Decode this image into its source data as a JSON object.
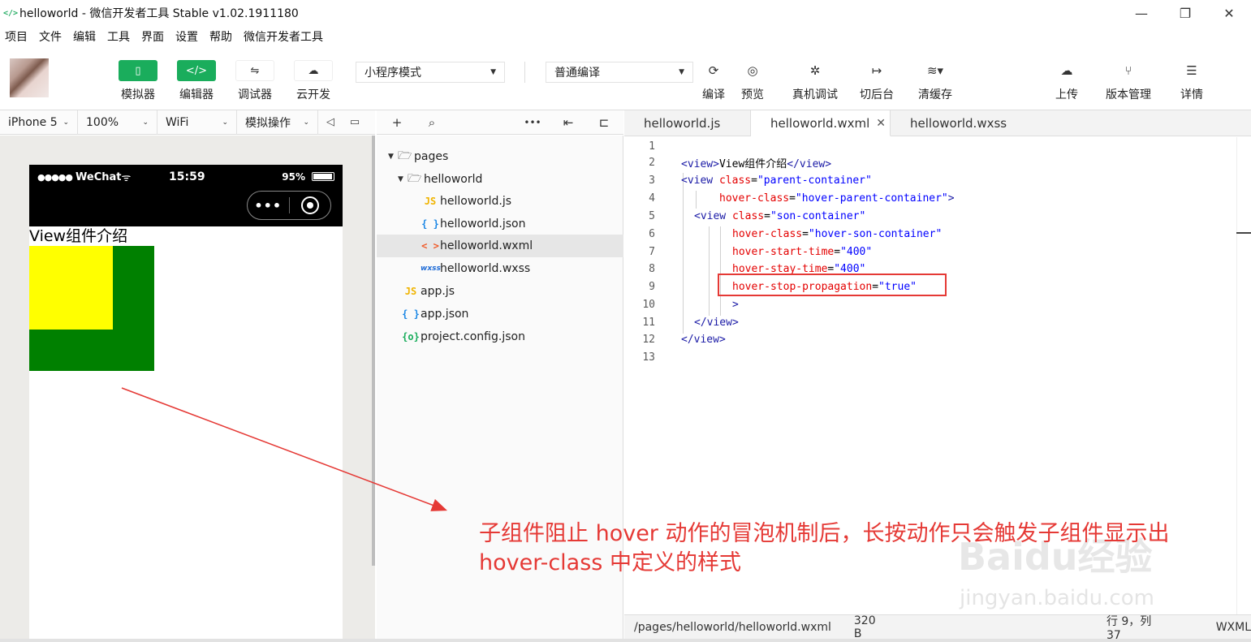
{
  "window": {
    "title": "helloworld - 微信开发者工具 Stable v1.02.1911180",
    "controls": [
      "—",
      "❐",
      "✕"
    ]
  },
  "menu": [
    "项目",
    "文件",
    "编辑",
    "工具",
    "界面",
    "设置",
    "帮助",
    "微信开发者工具"
  ],
  "toolbar": {
    "simulator": "模拟器",
    "editor": "编辑器",
    "debugger": "调试器",
    "cloud": "云开发",
    "mode_select": "小程序模式",
    "compile_select": "普通编译",
    "compile": "编译",
    "preview": "预览",
    "real_debug": "真机调试",
    "background": "切后台",
    "clear_cache": "清缓存",
    "upload": "上传",
    "version": "版本管理",
    "details": "详情",
    "icons": {
      "simulator": "▯",
      "editor": "</>",
      "debugger": "⇋",
      "cloud": "☁",
      "compile": "⟳",
      "preview": "◎",
      "real_debug": "✲",
      "background": "↦",
      "clear_cache": "≋▾",
      "upload": "☁",
      "version": "⑂",
      "details": "☰"
    }
  },
  "simbar": {
    "device": "iPhone 5",
    "zoom": "100%",
    "network": "WiFi",
    "operation": "模拟操作",
    "icons": [
      "◁",
      "▭"
    ]
  },
  "phone": {
    "signal": "●●●●●",
    "carrier": "WeChat",
    "wifi": "ᯤ",
    "time": "15:59",
    "battery": "95%",
    "battery_level": 0.95,
    "capsule_more": "•••",
    "page_text": "View组件介绍",
    "colors": {
      "parent": "#008000",
      "son": "#ffff00"
    }
  },
  "explorer": {
    "toolbar_icons": [
      "+",
      "⌕",
      "•••",
      "⇤",
      "⊏"
    ],
    "tree": [
      {
        "label": "pages",
        "type": "folder"
      },
      {
        "label": "helloworld",
        "type": "folder"
      },
      {
        "label": "helloworld.js",
        "type": "js",
        "icon": "JS"
      },
      {
        "label": "helloworld.json",
        "type": "json",
        "icon": "{ }"
      },
      {
        "label": "helloworld.wxml",
        "type": "wxml",
        "icon": "< >"
      },
      {
        "label": "helloworld.wxss",
        "type": "wxss",
        "icon": "wxss"
      },
      {
        "label": "app.js",
        "type": "js",
        "icon": "JS"
      },
      {
        "label": "app.json",
        "type": "json",
        "icon": "{ }"
      },
      {
        "label": "project.config.json",
        "type": "cfg",
        "icon": "{o}"
      }
    ]
  },
  "tabs": [
    {
      "label": "helloworld.js"
    },
    {
      "label": "helloworld.wxml",
      "close": "✕"
    },
    {
      "label": "helloworld.wxss"
    }
  ],
  "code": {
    "line_numbers": [
      "1",
      "2",
      "3",
      "4",
      "5",
      "6",
      "7",
      "8",
      "9",
      "10",
      "11",
      "12",
      "13"
    ],
    "l2": {
      "open": "<view>",
      "text": "View组件介绍",
      "close": "</view>"
    },
    "l3": {
      "open": "<view ",
      "attr": "class",
      "eq": "=",
      "val": "\"parent-container\""
    },
    "l4": {
      "attr": "hover-class",
      "eq": "=",
      "val": "\"hover-parent-container\"",
      "close": ">"
    },
    "l5": {
      "open": "<view ",
      "attr": "class",
      "eq": "=",
      "val": "\"son-container\""
    },
    "l6": {
      "attr": "hover-class",
      "eq": "=",
      "val": "\"hover-son-container\""
    },
    "l7": {
      "attr": "hover-start-time",
      "eq": "=",
      "val": "\"400\""
    },
    "l8": {
      "attr": "hover-stay-time",
      "eq": "=",
      "val": "\"400\""
    },
    "l9": {
      "attr": "hover-stop-propagation",
      "eq": "=",
      "val": "\"true\""
    },
    "l10": {
      "close": ">"
    },
    "l11": {
      "close": "</view>"
    },
    "l12": {
      "close": "</view>"
    }
  },
  "status": {
    "path": "/pages/helloworld/helloworld.wxml",
    "size": "320 B",
    "position": "行 9，列 37",
    "language": "WXML"
  },
  "annotation": {
    "line1": "子组件阻止 hover 动作的冒泡机制后，长按动作只会触发子组件显示出",
    "line2": "hover-class 中定义的样式",
    "color": "#e53935"
  },
  "watermark": {
    "main": "Baidu经验",
    "sub": "jingyan.baidu.com"
  }
}
